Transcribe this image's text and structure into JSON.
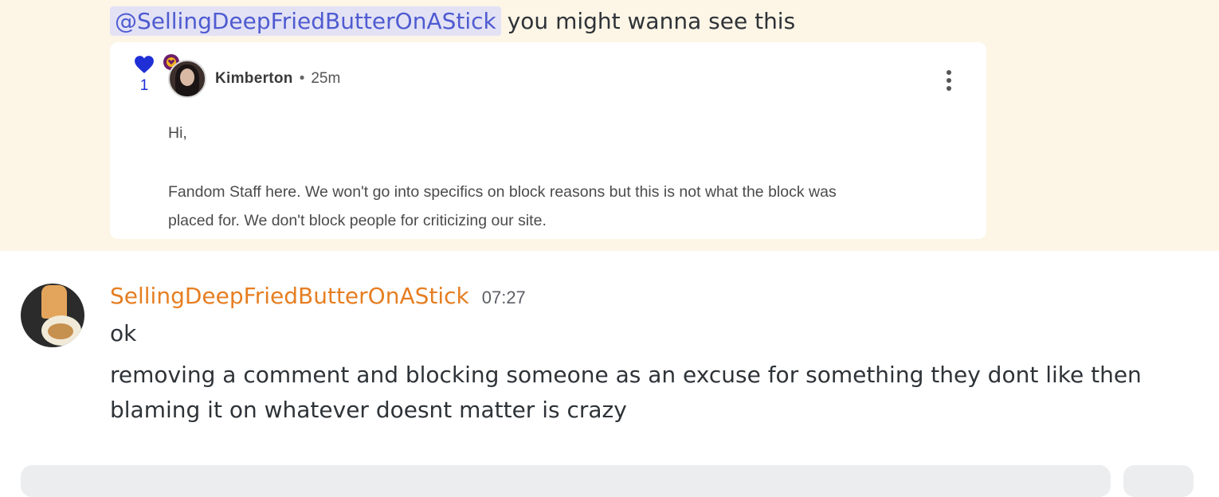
{
  "prev_message": {
    "mention": "@SellingDeepFriedButterOnAStick",
    "text": "you might wanna see this",
    "highlight_color": "#fdf5e6",
    "embed": {
      "vote_count": "1",
      "heart_color": "#1f2fd6",
      "author": "Kimberton",
      "separator": "•",
      "time": "25m",
      "body": {
        "greeting": "Hi,",
        "line1": "Fandom Staff here. We won't go into specifics on block reasons but this is not what the block was",
        "line2": "placed for. We don't block people for criticizing our site."
      }
    }
  },
  "message": {
    "username": "SellingDeepFriedButterOnAStick",
    "username_color": "#e67e22",
    "timestamp": "07:27",
    "lines": {
      "first": "ok",
      "second": "removing a comment and blocking someone as an excuse for something they dont like then",
      "third": "blaming it on whatever doesnt matter is crazy"
    }
  }
}
